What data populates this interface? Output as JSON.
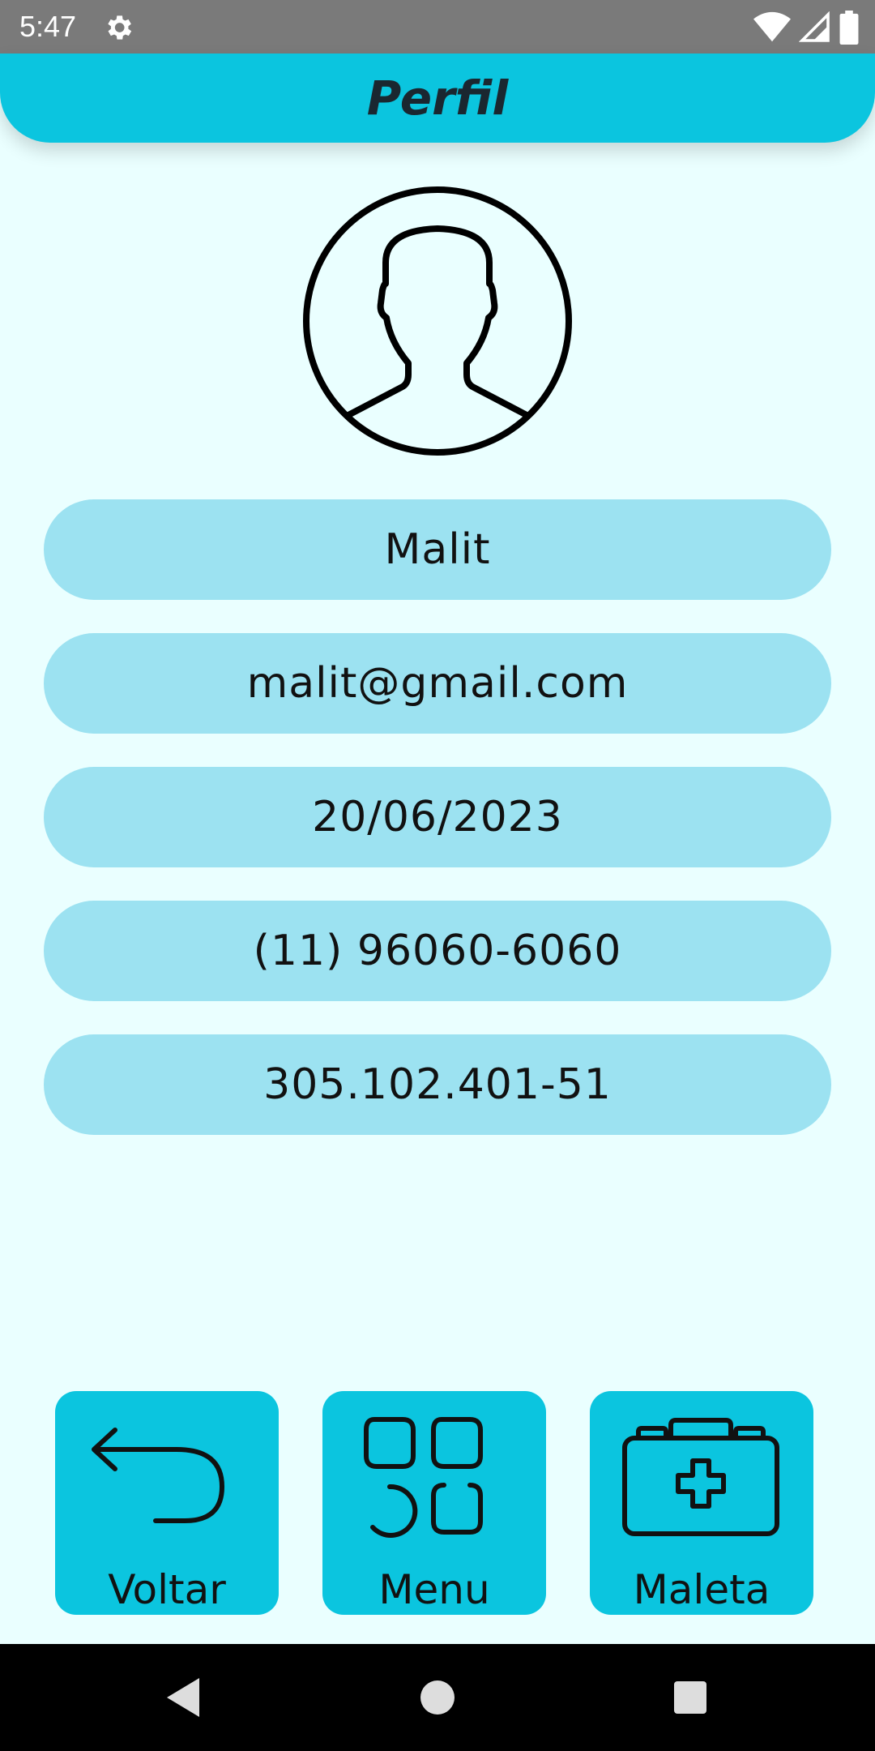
{
  "status_bar": {
    "time": "5:47",
    "icons": [
      "gear-icon",
      "wifi-icon",
      "signal-icon",
      "battery-icon"
    ]
  },
  "header": {
    "title": "Perfil"
  },
  "avatar": {
    "icon": "user-avatar-icon"
  },
  "profile": {
    "name": "Malit",
    "email": "malit@gmail.com",
    "date": "20/06/2023",
    "phone": "(11) 96060-6060",
    "cpf": "305.102.401-51"
  },
  "nav": {
    "back_label": "Voltar",
    "back_icon": "undo-arrow-icon",
    "menu_label": "Menu",
    "menu_icon": "grid-icon",
    "kit_label": "Maleta",
    "kit_icon": "first-aid-kit-icon"
  },
  "system_nav": {
    "icons": [
      "back-triangle-icon",
      "home-circle-icon",
      "recents-square-icon"
    ]
  },
  "colors": {
    "accent": "#0BC5DF",
    "field_bg": "#9CE2F1",
    "page_bg": "#EAFFFF"
  }
}
